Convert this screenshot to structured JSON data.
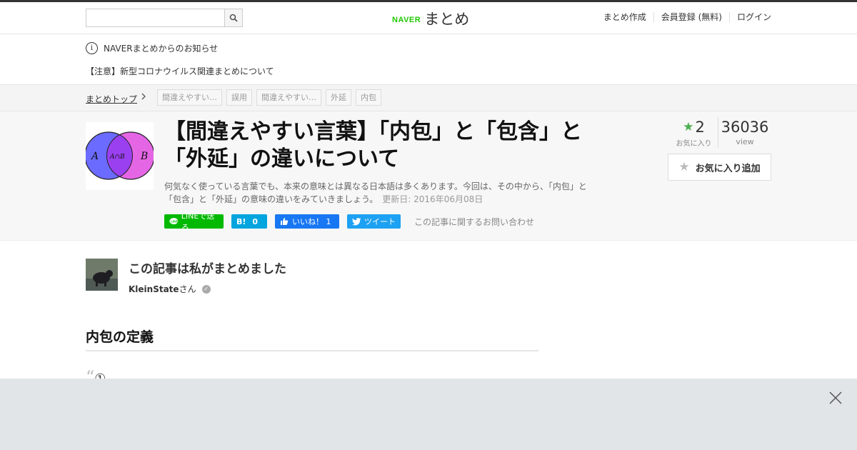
{
  "topbar": {
    "search": {
      "value": "",
      "placeholder": ""
    },
    "logo": {
      "brand": "NAVER",
      "name": "まとめ"
    },
    "links": [
      "まとめ作成",
      "会員登録 (無料)",
      "ログイン"
    ]
  },
  "notice": {
    "title": "NAVERまとめからのお知らせ",
    "item": "【注意】新型コロナウイルス関連まとめについて"
  },
  "breadcrumb": {
    "home": "まとめトップ",
    "tags": [
      "間違えやすい…",
      "誤用",
      "間違えやすい…",
      "外延",
      "内包"
    ]
  },
  "article": {
    "title": "【間違えやすい言葉】「内包」と「包含」と「外延」の違いについて",
    "description": "何気なく使っている言葉でも、本来の意味とは異なる日本語は多くあります。今回は、その中から、「内包」と「包含」と「外延」の意味の違いをみていきましょう。",
    "updated": "更新日: 2016年06月08日",
    "thumb_labels": {
      "a": "A",
      "b": "B",
      "ab": "A∩B"
    },
    "share": {
      "line": "LINEで送る",
      "hatena_count": "0",
      "fb": "いいね！ 1",
      "tweet": "ツイート"
    },
    "inquiry": "この記事に関するお問い合わせ",
    "stats": {
      "favorites": "2",
      "favorites_label": "お気に入り",
      "views": "36036",
      "views_label": "view"
    },
    "fav_button": "お気に入り追加"
  },
  "author": {
    "heading": "この記事は私がまとめました",
    "name": "KleinState",
    "suffix": "さん"
  },
  "section": {
    "heading": "内包の定義",
    "quote_marker": "①"
  },
  "colors": {
    "line": "#00b900",
    "hatena": "#00a4de",
    "facebook": "#1877f2",
    "twitter": "#1da1f2",
    "naver": "#1ec800"
  }
}
